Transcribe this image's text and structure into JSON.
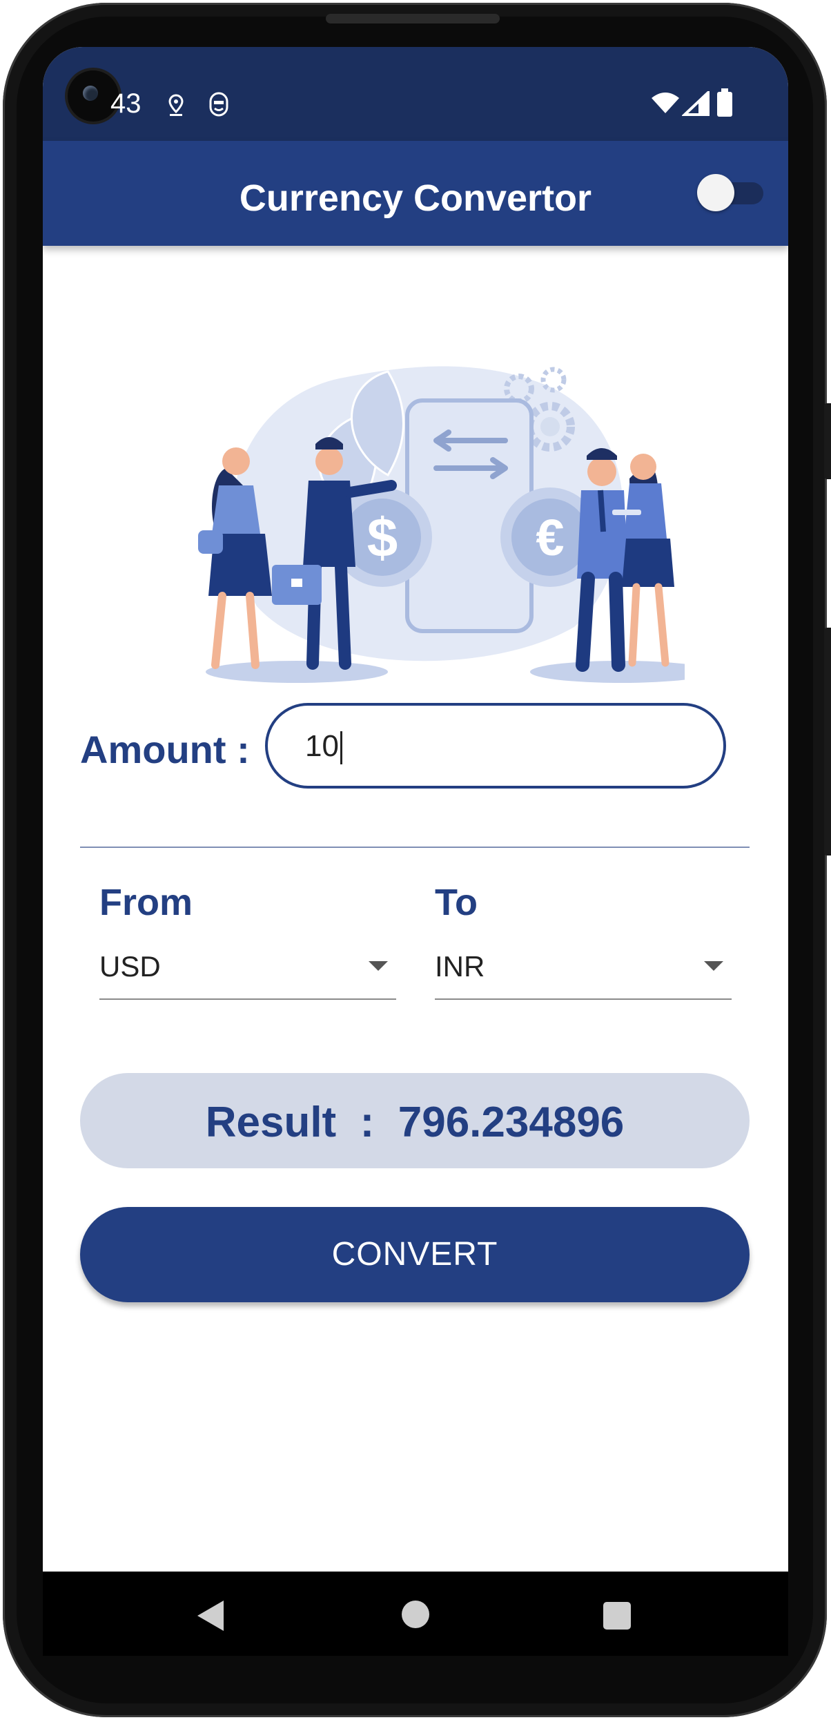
{
  "status_bar": {
    "time": "43",
    "icons": [
      "location-icon",
      "privacy-icon",
      "wifi-icon",
      "signal-icon",
      "battery-icon"
    ]
  },
  "app_bar": {
    "title": "Currency Convertor",
    "toggle_on": false
  },
  "illustration": {
    "symbols": [
      "$",
      "€"
    ]
  },
  "form": {
    "amount_label": "Amount  :",
    "amount_value": "10",
    "from_label": "From",
    "from_value": "USD",
    "to_label": "To",
    "to_value": "INR"
  },
  "result": {
    "text": "Result  :  796.234896"
  },
  "convert_button": {
    "label": "CONVERT"
  },
  "colors": {
    "primary": "#233f82",
    "status_bar": "#1b2f5e",
    "result_background": "#d3d9e7"
  },
  "nav": {
    "icons": [
      "back-icon",
      "home-icon",
      "recents-icon"
    ]
  }
}
